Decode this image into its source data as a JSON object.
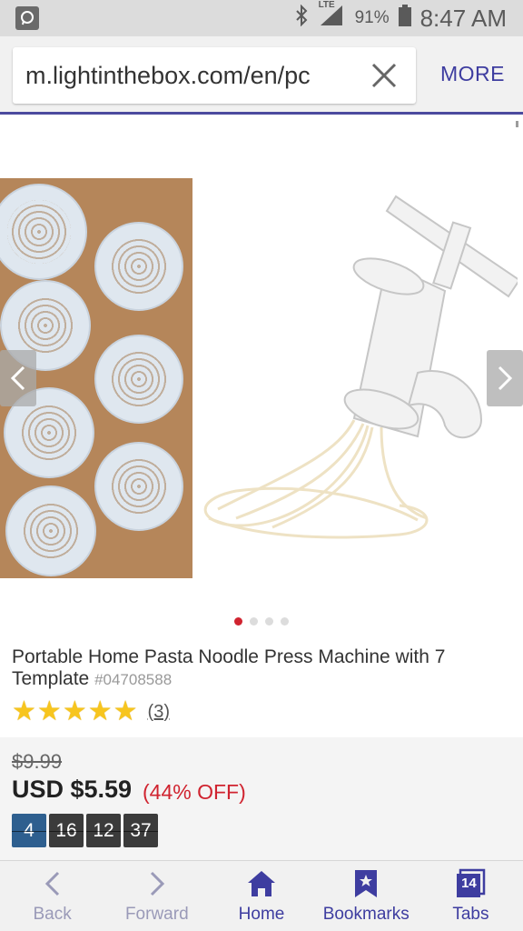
{
  "status_bar": {
    "network": "LTE",
    "battery_percent": "91%",
    "time": "8:47 AM"
  },
  "browser": {
    "url": "m.lightinthebox.com/en/pc",
    "more_label": "MORE"
  },
  "gallery": {
    "slide_count": 4,
    "active_slide": 1
  },
  "product": {
    "title": "Portable Home Pasta Noodle Press Machine with 7 Template",
    "sku": "#04708588",
    "rating_stars": 5,
    "review_count": "(3)"
  },
  "pricing": {
    "original_price": "$9.99",
    "sale_price": "USD $5.59",
    "discount": "(44% OFF)",
    "countdown": {
      "days": "4",
      "hours": "16",
      "minutes": "12",
      "seconds": "37"
    }
  },
  "bottom_nav": {
    "back": "Back",
    "forward": "Forward",
    "home": "Home",
    "bookmarks": "Bookmarks",
    "tabs": "Tabs",
    "tab_count": "14"
  },
  "colors": {
    "accent": "#3e3da0",
    "sale_red": "#d0232f",
    "star_yellow": "#f7c51e",
    "countdown_days": "#2e5f8f",
    "countdown_box": "#3b3b3b"
  }
}
